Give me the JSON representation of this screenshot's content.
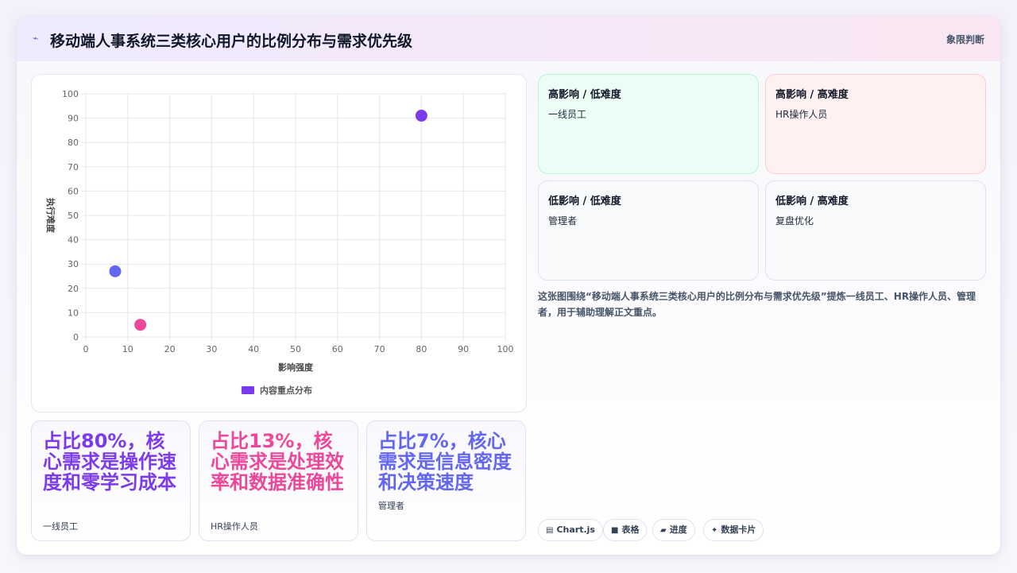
{
  "header": {
    "title": "移动端人事系统三类核心用户的比例分布与需求优先级",
    "tag": "象限判断"
  },
  "chart_data": {
    "type": "scatter",
    "xlabel": "影响强度",
    "ylabel": "执行难度",
    "xlim": [
      0,
      100
    ],
    "ylim": [
      0,
      100
    ],
    "x_ticks": [
      "0",
      "10",
      "20",
      "30",
      "40",
      "50",
      "60",
      "70",
      "80",
      "90",
      "100"
    ],
    "y_ticks": [
      "0",
      "10",
      "20",
      "30",
      "40",
      "50",
      "60",
      "70",
      "80",
      "90",
      "100"
    ],
    "grid": true,
    "legend": "bottom",
    "series": [
      {
        "name": "内容重点分布",
        "color": "#7c3aed",
        "points": [
          {
            "x": 80,
            "y": 91,
            "color": "#7c3aed"
          },
          {
            "x": 7,
            "y": 27,
            "color": "#6366f1"
          },
          {
            "x": 13,
            "y": 5,
            "color": "#ec4899"
          }
        ]
      }
    ]
  },
  "stats": [
    {
      "text": "占比80%，核心需求是操作速度和零学习成本",
      "who": "一线员工",
      "color": "#7c3aed"
    },
    {
      "text": "占比13%，核心需求是处理效率和数据准确性",
      "who": "HR操作人员",
      "color": "#ec4899"
    },
    {
      "text": "占比7%，核心需求是信息密度和决策速度",
      "who": "管理者",
      "color": "#6366f1"
    }
  ],
  "quadrants": [
    {
      "title": "高影响 / 低难度",
      "item": "一线员工",
      "bg": "#ecfdf5",
      "border": "#bbf7d0"
    },
    {
      "title": "高影响 / 高难度",
      "item": "HR操作人员",
      "bg": "#fff1f2",
      "border": "#fecdd3"
    },
    {
      "title": "低影响 / 低难度",
      "item": "管理者",
      "bg": "#f8fafc",
      "border": "#dde3ec"
    },
    {
      "title": "低影响 / 高难度",
      "item": "复盘优化",
      "bg": "#f8fafc",
      "border": "#dde3ec"
    }
  ],
  "note": "这张图围绕“移动端人事系统三类核心用户的比例分布与需求优先级”提炼一线员工、HR操作人员、管理者，用于辅助理解正文重点。",
  "chips": [
    {
      "icon": "▤",
      "icon_name": "chart-icon",
      "label": "Chart.js"
    },
    {
      "icon": "■",
      "icon_name": "table-icon",
      "label": "表格"
    },
    {
      "icon": "▰",
      "icon_name": "progress-icon",
      "label": "进度"
    },
    {
      "icon": "✦",
      "icon_name": "sparkle-icon",
      "label": "数据卡片"
    }
  ]
}
